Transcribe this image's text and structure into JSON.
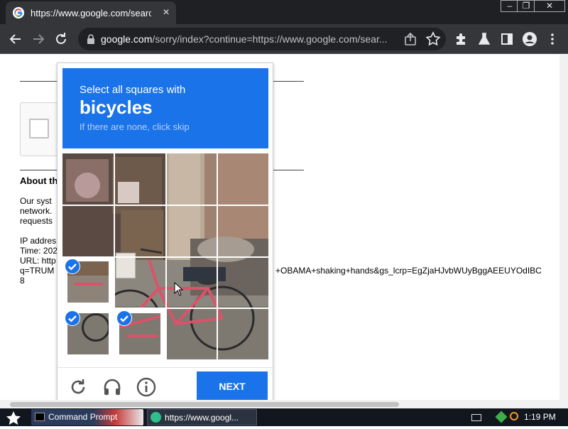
{
  "browser": {
    "tab_title": "https://www.google.com/search?q=",
    "tab_close": "×",
    "url_host": "google.com",
    "url_path": "/sorry/index?continue=https://www.google.com/sear...",
    "window_controls": [
      "–",
      "❐",
      "✕"
    ]
  },
  "page": {
    "about_title": "About th",
    "body_lines": [
      "Our syst",
      "network.",
      "requests"
    ],
    "ip_line": "IP addres",
    "time_line": "Time: 202",
    "url_line": "URL: http",
    "q_line_left": "q=TRUM",
    "q_line_right": "+OBAMA+shaking+hands&gs_lcrp=EgZjaHJvbWUyBggAEEUYOdIBC",
    "eight": "8"
  },
  "captcha": {
    "intro": "Select all squares with",
    "target": "bicycles",
    "hint": "If there are none, click skip",
    "next_label": "NEXT",
    "selected_tiles": [
      8,
      12,
      13
    ]
  },
  "taskbar": {
    "cmd_label": "Command Prompt",
    "chrome_label": "https://www.googl...",
    "clock": "1:19 PM"
  },
  "colors": {
    "accent": "#1a73e8",
    "chrome_dark": "#35363a",
    "bike_frame": "#d9536a"
  }
}
